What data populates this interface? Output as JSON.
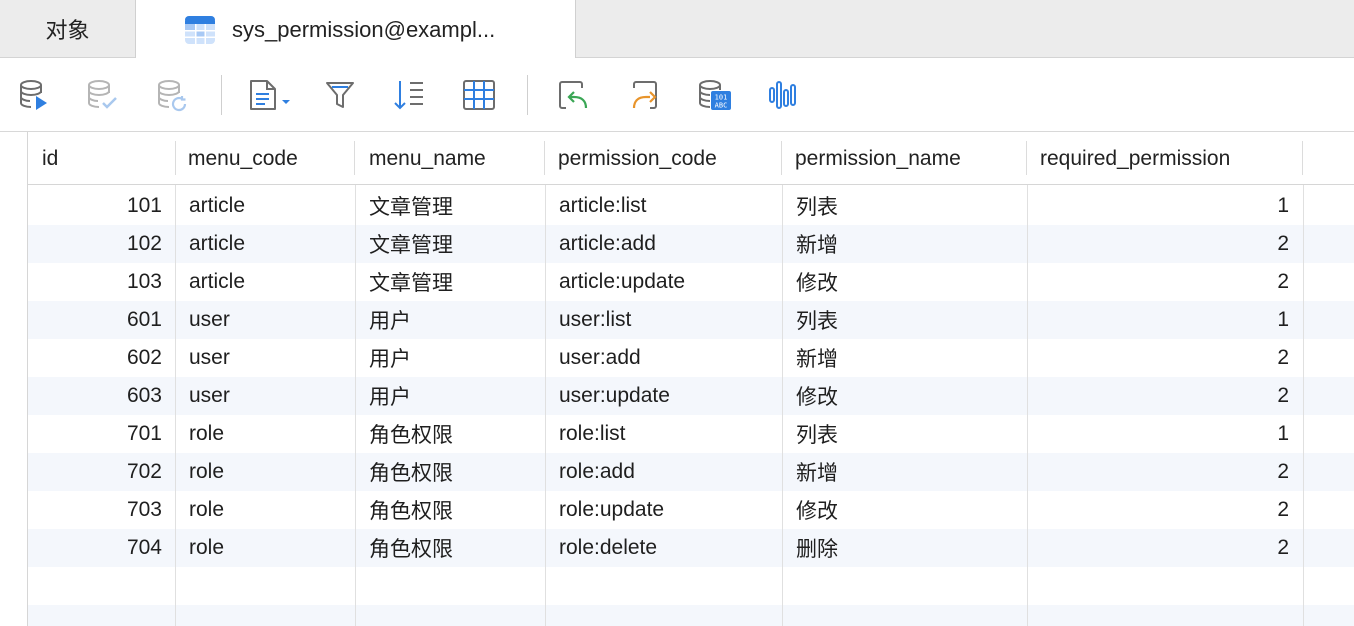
{
  "tabs": [
    {
      "label": "对象"
    },
    {
      "label": "sys_permission@exampl..."
    }
  ],
  "colors": {
    "accent_blue": "#2f7fe0",
    "icon_gray": "#6d6d6d",
    "icon_disabled": "#b5b5b5",
    "undo_green": "#3aa655",
    "redo_orange": "#e8942b",
    "row_alt": "#f4f7fc"
  },
  "toolbar": {
    "icons": [
      "run-query-icon",
      "commit-icon",
      "rollback-icon",
      "text-view-icon",
      "filter-icon",
      "sort-icon",
      "grid-view-icon",
      "undo-icon",
      "redo-icon",
      "data-types-icon",
      "chart-icon"
    ]
  },
  "table": {
    "columns": [
      "id",
      "menu_code",
      "menu_name",
      "permission_code",
      "permission_name",
      "required_permission"
    ],
    "rows": [
      [
        "101",
        "article",
        "文章管理",
        "article:list",
        "列表",
        "1"
      ],
      [
        "102",
        "article",
        "文章管理",
        "article:add",
        "新增",
        "2"
      ],
      [
        "103",
        "article",
        "文章管理",
        "article:update",
        "修改",
        "2"
      ],
      [
        "601",
        "user",
        "用户",
        "user:list",
        "列表",
        "1"
      ],
      [
        "602",
        "user",
        "用户",
        "user:add",
        "新增",
        "2"
      ],
      [
        "603",
        "user",
        "用户",
        "user:update",
        "修改",
        "2"
      ],
      [
        "701",
        "role",
        "角色权限",
        "role:list",
        "列表",
        "1"
      ],
      [
        "702",
        "role",
        "角色权限",
        "role:add",
        "新增",
        "2"
      ],
      [
        "703",
        "role",
        "角色权限",
        "role:update",
        "修改",
        "2"
      ],
      [
        "704",
        "role",
        "角色权限",
        "role:delete",
        "删除",
        "2"
      ]
    ]
  }
}
